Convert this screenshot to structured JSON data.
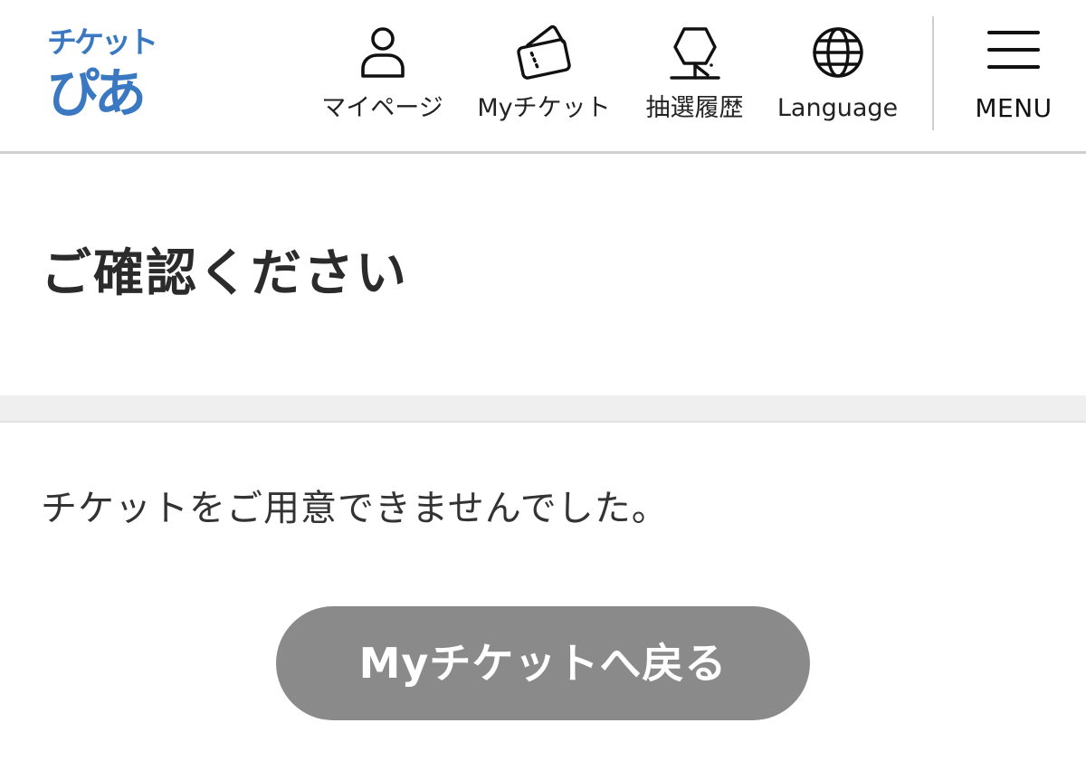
{
  "logo": {
    "top_text": "チケット",
    "bottom_text": "ぴあ",
    "brand_color": "#3a78c2"
  },
  "nav": {
    "items": [
      {
        "label": "マイページ",
        "icon": "person-icon"
      },
      {
        "label": "Myチケット",
        "icon": "ticket-icon"
      },
      {
        "label": "抽選履歴",
        "icon": "lottery-icon"
      },
      {
        "label": "Language",
        "icon": "globe-icon"
      }
    ],
    "menu_label": "MENU",
    "menu_icon": "hamburger-icon",
    "divider_color": "#cfcfcf"
  },
  "page": {
    "title": "ご確認ください",
    "band_color": "#efefef"
  },
  "content": {
    "message": "チケットをご用意できませんでした。",
    "back_button_label": "Myチケットへ戻る",
    "back_button_color": "#8a8a8a"
  }
}
